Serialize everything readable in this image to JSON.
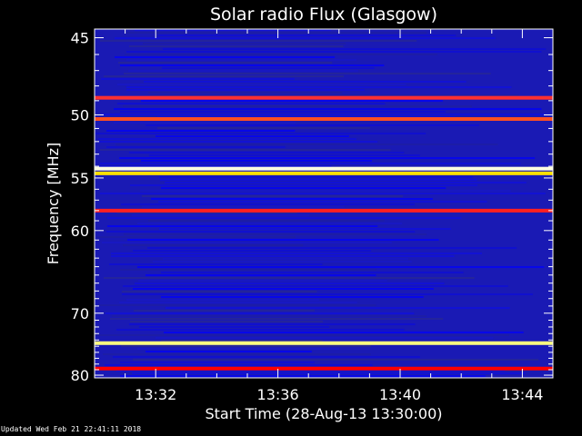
{
  "chart_data": {
    "type": "heatmap",
    "title": "Solar radio Flux (Glasgow)",
    "xlabel": "Start Time (28-Aug-13 13:30:00)",
    "ylabel": "Frequency [MHz]",
    "x_ticks": [
      "13:32",
      "13:36",
      "13:40",
      "13:44"
    ],
    "x_tick_minutes": [
      2,
      6,
      10,
      14
    ],
    "x_range_minutes": [
      0,
      15
    ],
    "y_ticks": [
      45,
      50,
      55,
      60,
      70,
      80
    ],
    "y_range": [
      44.5,
      80.5
    ],
    "y_scale": "reciprocal",
    "grid": false,
    "colormap": [
      "#0000ff",
      "#ff0000",
      "#ffff00",
      "#ffffff"
    ],
    "background_color": "#1a1ab4",
    "bright_bands": [
      {
        "freq": 48.8,
        "color": "#ff3030"
      },
      {
        "freq": 50.3,
        "color": "#ff5020"
      },
      {
        "freq": 54.2,
        "color": "#ffffe0"
      },
      {
        "freq": 54.6,
        "color": "#ffe000"
      },
      {
        "freq": 58.0,
        "color": "#ff2020"
      },
      {
        "freq": 74.5,
        "color": "#ffff80"
      },
      {
        "freq": 78.8,
        "color": "#ff0000"
      }
    ]
  },
  "footer": "Updated Wed Feb 21 22:41:11 2018"
}
